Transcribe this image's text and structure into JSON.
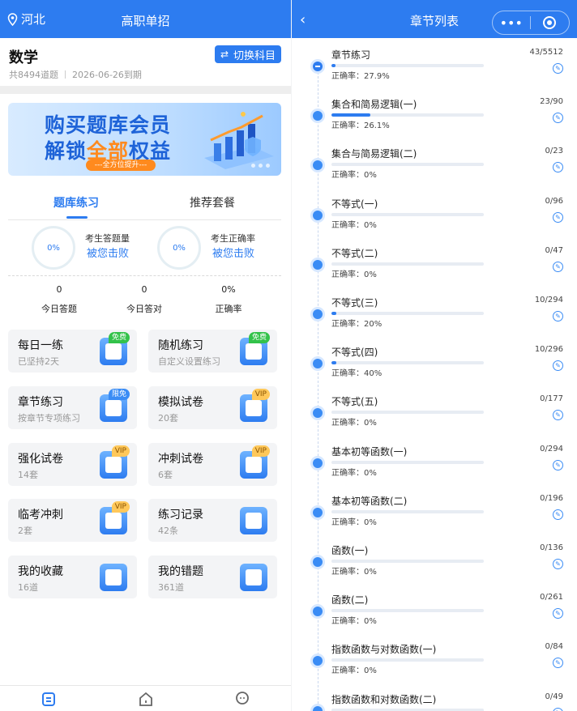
{
  "left": {
    "header": {
      "location": "河北",
      "title": "高职单招"
    },
    "subject": {
      "name": "数学",
      "count": "共8494道题",
      "expire": "2026-06-26到期",
      "switch_label": "切换科目"
    },
    "banner": {
      "line1": "购买题库会员",
      "line2_a": "解锁",
      "line2_b": "全部",
      "line2_c": "权益",
      "pill": "---全方位提升---"
    },
    "tabs": [
      {
        "label": "题库练习",
        "active": true
      },
      {
        "label": "推荐套餐",
        "active": false
      }
    ],
    "stats": [
      {
        "ring": "0%",
        "caption": "考生答题量",
        "link": "被您击败"
      },
      {
        "ring": "0%",
        "caption": "考生正确率",
        "link": "被您击败"
      }
    ],
    "today": [
      {
        "value": "0",
        "label": "今日答题"
      },
      {
        "value": "0",
        "label": "今日答对"
      },
      {
        "value": "0%",
        "label": "正确率"
      }
    ],
    "cards": [
      {
        "title": "每日一练",
        "sub": "已坚持2天",
        "badge": "免费",
        "icon": "calendar-icon"
      },
      {
        "title": "随机练习",
        "sub": "自定义设置练习",
        "badge": "免费",
        "icon": "shuffle-icon"
      },
      {
        "title": "章节练习",
        "sub": "按章节专项练习",
        "badge": "限免",
        "icon": "document-icon"
      },
      {
        "title": "模拟试卷",
        "sub": "20套",
        "badge": "VIP",
        "icon": "edit-paper-icon"
      },
      {
        "title": "强化试卷",
        "sub": "14套",
        "badge": "VIP",
        "icon": "edit-paper-icon"
      },
      {
        "title": "冲刺试卷",
        "sub": "6套",
        "badge": "VIP",
        "icon": "edit-paper-icon"
      },
      {
        "title": "临考冲刺",
        "sub": "2套",
        "badge": "VIP",
        "icon": "edit-paper-icon"
      },
      {
        "title": "练习记录",
        "sub": "42条",
        "badge": "",
        "icon": "record-icon"
      },
      {
        "title": "我的收藏",
        "sub": "16道",
        "badge": "",
        "icon": "star-icon"
      },
      {
        "title": "我的错题",
        "sub": "361道",
        "badge": "",
        "icon": "wrong-icon"
      }
    ]
  },
  "right": {
    "header": {
      "title": "章节列表",
      "menu": "•••",
      "minimize": "—"
    },
    "chapters": [
      {
        "name": "章节练习",
        "count": "43/5512",
        "accuracy": "正确率：27.9%",
        "progress": 0.008,
        "expanded": true
      },
      {
        "name": "集合和简易逻辑(一)",
        "count": "23/90",
        "accuracy": "正确率：26.1%",
        "progress": 0.256
      },
      {
        "name": "集合与简易逻辑(二)",
        "count": "0/23",
        "accuracy": "正确率：0%",
        "progress": 0
      },
      {
        "name": "不等式(一)",
        "count": "0/96",
        "accuracy": "正确率：0%",
        "progress": 0
      },
      {
        "name": "不等式(二)",
        "count": "0/47",
        "accuracy": "正确率：0%",
        "progress": 0
      },
      {
        "name": "不等式(三)",
        "count": "10/294",
        "accuracy": "正确率：20%",
        "progress": 0.034
      },
      {
        "name": "不等式(四)",
        "count": "10/296",
        "accuracy": "正确率：40%",
        "progress": 0.034
      },
      {
        "name": "不等式(五)",
        "count": "0/177",
        "accuracy": "正确率：0%",
        "progress": 0
      },
      {
        "name": "基本初等函数(一)",
        "count": "0/294",
        "accuracy": "正确率：0%",
        "progress": 0
      },
      {
        "name": "基本初等函数(二)",
        "count": "0/196",
        "accuracy": "正确率：0%",
        "progress": 0
      },
      {
        "name": "函数(一)",
        "count": "0/136",
        "accuracy": "正确率：0%",
        "progress": 0
      },
      {
        "name": "函数(二)",
        "count": "0/261",
        "accuracy": "正确率：0%",
        "progress": 0
      },
      {
        "name": "指数函数与对数函数(一)",
        "count": "0/84",
        "accuracy": "正确率：0%",
        "progress": 0
      },
      {
        "name": "指数函数和对数函数(二)",
        "count": "0/49",
        "accuracy": "",
        "progress": 0
      }
    ]
  },
  "colors": {
    "primary": "#2d7cf0",
    "free": "#33c24a",
    "vip": "#ffc85a"
  }
}
